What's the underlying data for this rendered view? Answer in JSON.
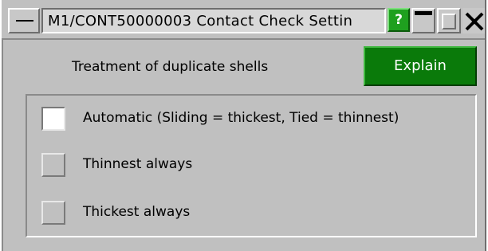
{
  "window": {
    "title": "M1/CONT50000003 Contact Check Settin",
    "help_label": "?",
    "icons": {
      "system_menu": "system-menu-icon",
      "minimize": "minimize-icon",
      "maximize": "maximize-icon",
      "close": "close-icon"
    }
  },
  "panel": {
    "heading": "Treatment of duplicate shells",
    "explain_label": "Explain",
    "options": [
      {
        "label": "Automatic (Sliding = thickest, Tied = thinnest)",
        "checked": false,
        "style": "white"
      },
      {
        "label": "Thinnest always",
        "checked": false,
        "style": "grey"
      },
      {
        "label": "Thickest always",
        "checked": false,
        "style": "grey"
      }
    ]
  },
  "colors": {
    "window_bg": "#c0c0c0",
    "explain_bg": "#0a7a0a",
    "help_bg": "#1fa01f"
  }
}
